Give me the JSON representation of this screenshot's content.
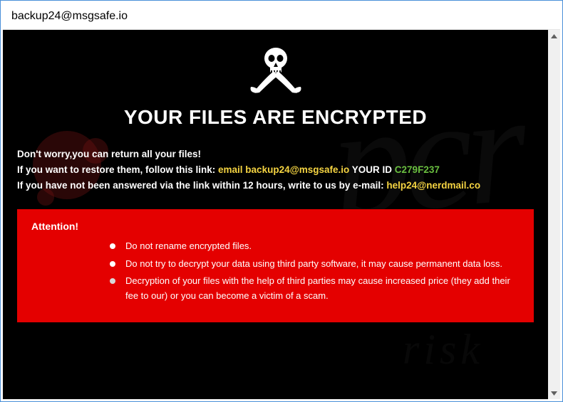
{
  "titlebar": {
    "text": "backup24@msgsafe.io"
  },
  "main": {
    "title": "YOUR FILES ARE ENCRYPTED",
    "line1": "Don't worry,you can return all your files!",
    "line2_prefix": "If you want to restore them, follow this link: ",
    "line2_email_label": "email backup24@msgsafe.io",
    "line2_id_label": "  YOUR ID ",
    "line2_id_value": "C279F237",
    "line3_prefix": "If you have not been answered via the link within 12 hours, write to us by e-mail: ",
    "line3_email": "help24@nerdmail.co"
  },
  "attention": {
    "title": "Attention!",
    "items": [
      "Do not rename encrypted files.",
      "Do not try to decrypt your data using third party software, it may cause permanent data loss.",
      "Decryption of your files with the help of third parties may cause increased price (they add their fee to our) or you can become a victim of a scam."
    ]
  }
}
